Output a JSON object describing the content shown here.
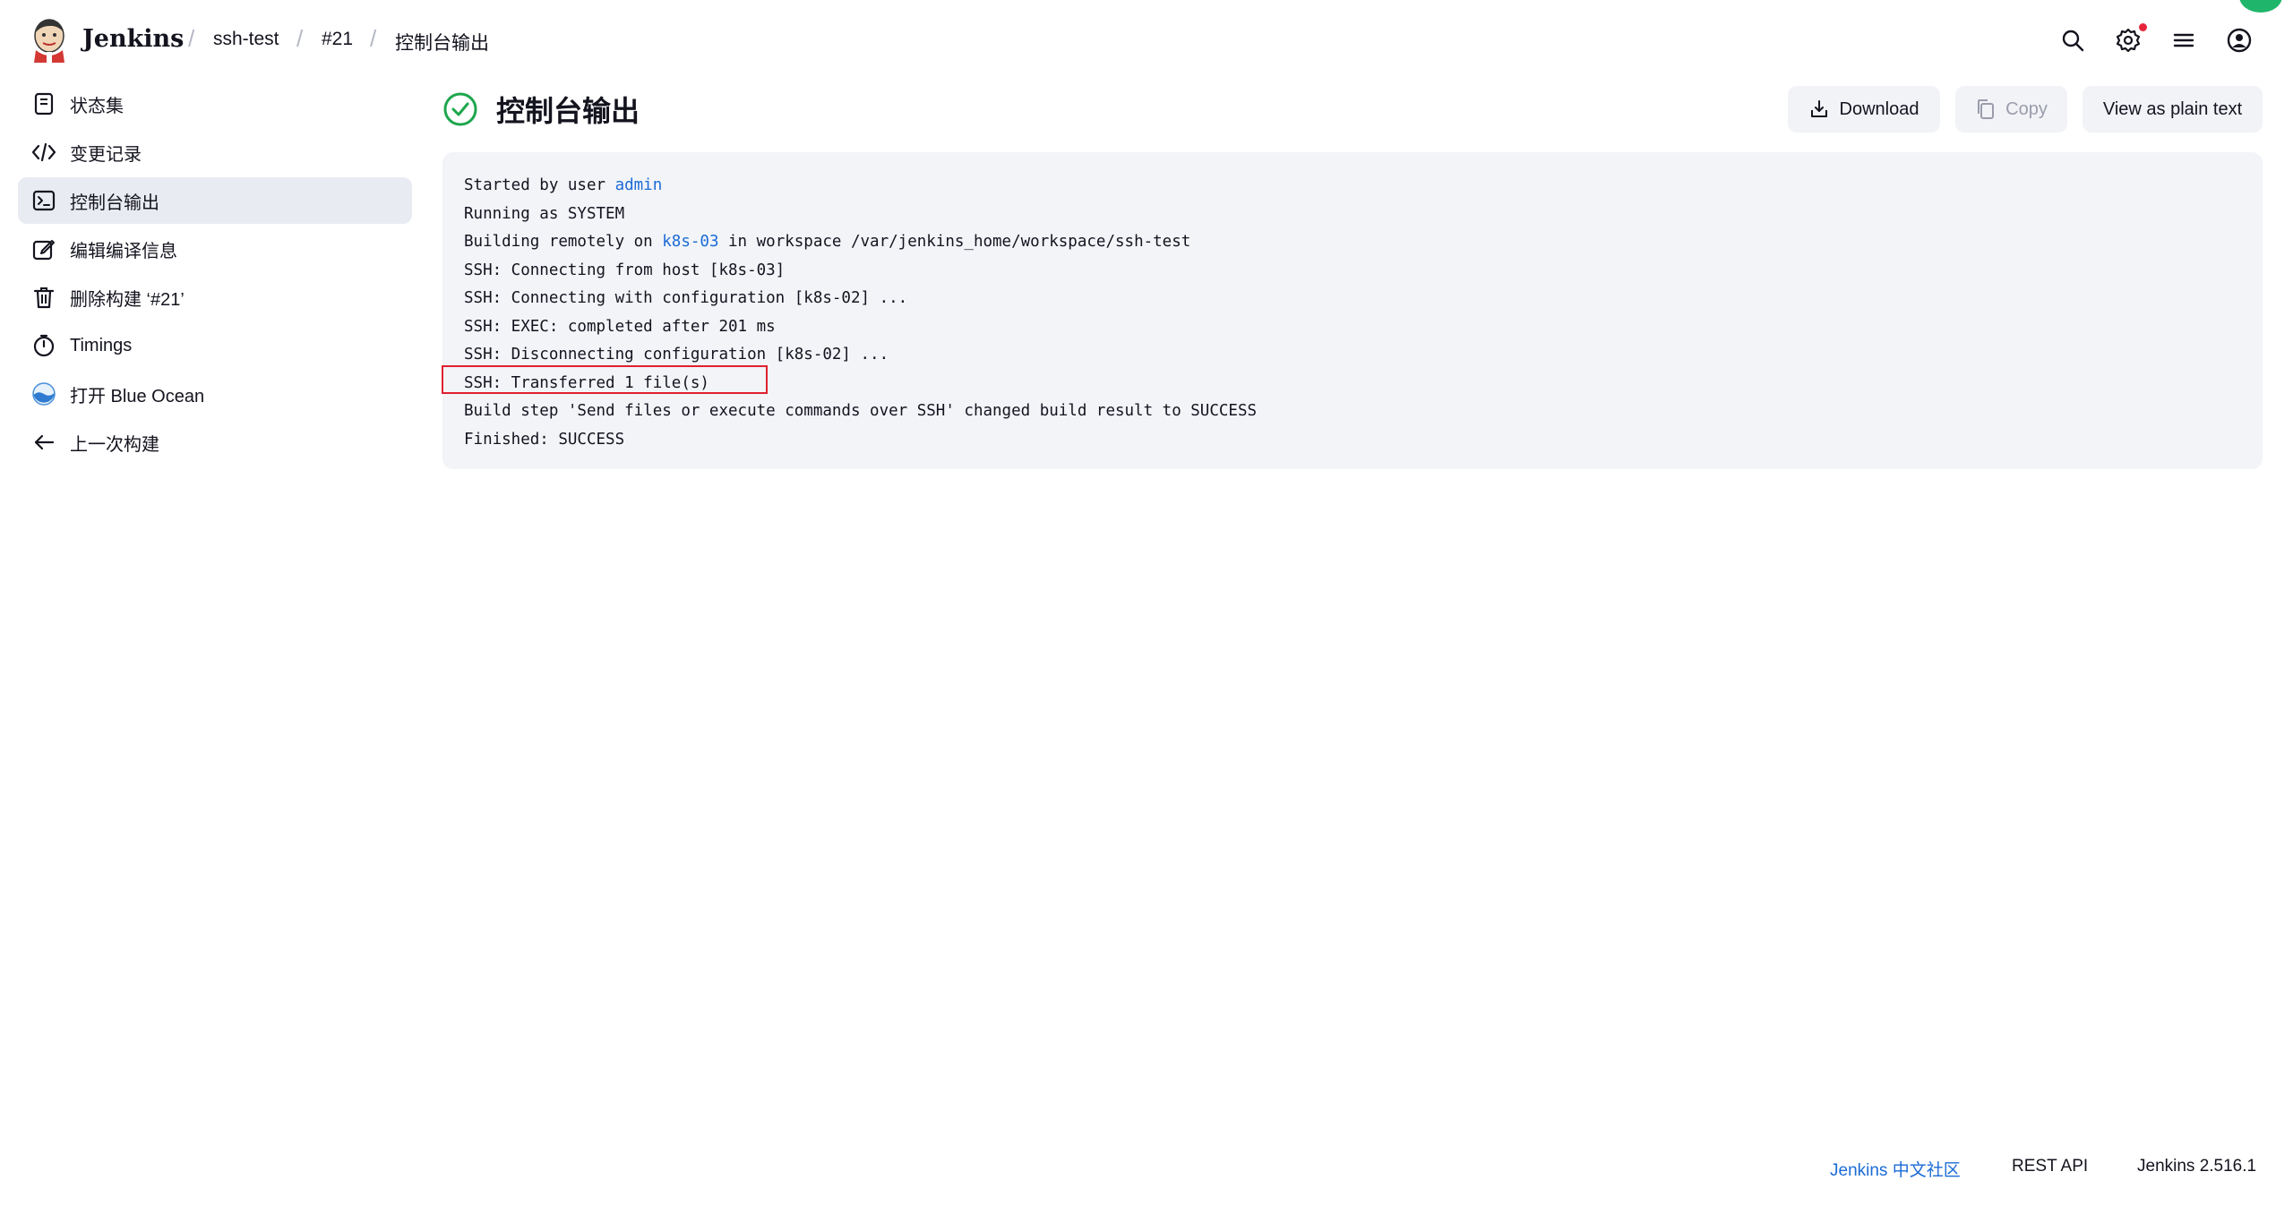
{
  "header": {
    "brand": "Jenkins",
    "breadcrumbs": [
      "ssh-test",
      "#21",
      "控制台输出"
    ],
    "separator": "/",
    "icons": [
      "search-icon",
      "settings-icon",
      "menu-icon",
      "user-icon"
    ],
    "notification_color": "#e6253b"
  },
  "sidebar": {
    "items": [
      {
        "label": "状态集",
        "icon": "document-icon"
      },
      {
        "label": "变更记录",
        "icon": "code-icon"
      },
      {
        "label": "控制台输出",
        "icon": "terminal-icon",
        "active": true
      },
      {
        "label": "编辑编译信息",
        "icon": "edit-icon"
      },
      {
        "label": "删除构建 ‘#21’",
        "icon": "trash-icon"
      },
      {
        "label": "Timings",
        "icon": "stopwatch-icon"
      },
      {
        "label": "打开 Blue Ocean",
        "icon": "blue-ocean-icon"
      },
      {
        "label": "上一次构建",
        "icon": "arrow-left-icon"
      }
    ]
  },
  "main": {
    "title": "控制台输出",
    "status": "success",
    "status_color": "#1ea64d",
    "buttons": {
      "download": "Download",
      "copy": "Copy",
      "plain_text": "View as plain text"
    },
    "console": {
      "lines": {
        "l1_prefix": "Started by user ",
        "l1_link": "admin",
        "l2": "Running as SYSTEM",
        "l3_prefix": "Building remotely on ",
        "l3_link": "k8s-03",
        "l3_suffix": " in workspace /var/jenkins_home/workspace/ssh-test",
        "l4": "SSH: Connecting from host [k8s-03]",
        "l5": "SSH: Connecting with configuration [k8s-02] ...",
        "l6": "SSH: EXEC: completed after 201 ms",
        "l7": "SSH: Disconnecting configuration [k8s-02] ...",
        "l8": "SSH: Transferred 1 file(s)",
        "l9": "Build step 'Send files or execute commands over SSH' changed build result to SUCCESS",
        "l10": "Finished: SUCCESS"
      },
      "highlight_color": "#e0202f"
    }
  },
  "footer": {
    "community": "Jenkins 中文社区",
    "rest_api": "REST API",
    "version": "Jenkins 2.516.1"
  }
}
